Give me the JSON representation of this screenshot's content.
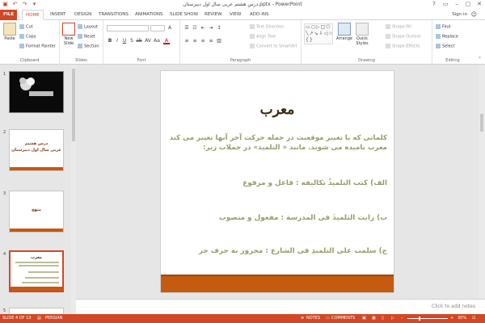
{
  "app": {
    "title": "درس هشتم عربی سال اول دبیرستان.pptx - PowerPoint",
    "window_controls": [
      "?",
      "▭",
      "–",
      "▢",
      "✕"
    ]
  },
  "quick_access": [
    "▣",
    "↶",
    "↷",
    "▾"
  ],
  "tabs": {
    "items": [
      "FILE",
      "HOME",
      "INSERT",
      "DESIGN",
      "TRANSITIONS",
      "ANIMATIONS",
      "SLIDE SHOW",
      "REVIEW",
      "VIEW",
      "ADD-INS"
    ],
    "active": "HOME",
    "sign_in": "Sign in"
  },
  "ribbon": {
    "clipboard": {
      "name": "Clipboard",
      "paste": "Paste",
      "cut": "Cut",
      "copy": "Copy",
      "format_painter": "Format Painter"
    },
    "slides": {
      "name": "Slides",
      "new_slide": "New Slide",
      "layout": "Layout",
      "reset": "Reset",
      "section": "Section"
    },
    "font": {
      "name": "Font",
      "buttons": [
        "B",
        "I",
        "U",
        "S",
        "ab",
        "AV",
        "Aa",
        "A"
      ]
    },
    "paragraph": {
      "name": "Paragraph",
      "text_direction": "Text Direction",
      "align_text": "Align Text",
      "convert_smartart": "Convert to SmartArt"
    },
    "drawing": {
      "name": "Drawing",
      "shapes_glyphs": "▭○▷□⬠ ╲↗↘⇩◁☆ {}⌒△▭▷◇",
      "arrange": "Arrange",
      "quick_styles": "Quick Styles",
      "shape_fill": "Shape Fill",
      "shape_outline": "Shape Outline",
      "shape_effects": "Shape Effects"
    },
    "editing": {
      "name": "Editing",
      "find": "Find",
      "replace": "Replace",
      "select": "Select"
    }
  },
  "thumbnails": [
    {
      "number": "1",
      "caption": ""
    },
    {
      "number": "2",
      "caption_line1": "درس هشتم",
      "caption_line2": "عربی سال اول دبیرستان"
    },
    {
      "number": "3",
      "caption": "منهج"
    },
    {
      "number": "4",
      "caption": "معرب"
    },
    {
      "number": "5",
      "caption": ""
    }
  ],
  "slide": {
    "title": "معرب",
    "line1": "کلماتی که با تغییر موقعیت در جمله حرکت آخر آنها تغییر می کند",
    "line2": "معرب نامیده می شوند. مانند « التلمیذ» در جملات زیر:",
    "ex_a": "الف) کتب التلمیذُ تکالیفه : فاعل و مرفوع",
    "ex_b": "ب) رایت التلمیذَ فی المدرسة : مفعول و منصوب",
    "ex_c": "ج) سلمت علی التلمیذِ فی الشارع : مجرور به حرف جر"
  },
  "notes": {
    "placeholder": "Click to add notes"
  },
  "status": {
    "slide_count": "SLIDE 4 OF 13",
    "language": "PERSIAN",
    "notes": "NOTES",
    "comments": "COMMENTS",
    "zoom": "30%"
  },
  "colors": {
    "accent": "#d24726",
    "slide_band": "#c55a11",
    "slide_text": "#9a9a6a"
  }
}
